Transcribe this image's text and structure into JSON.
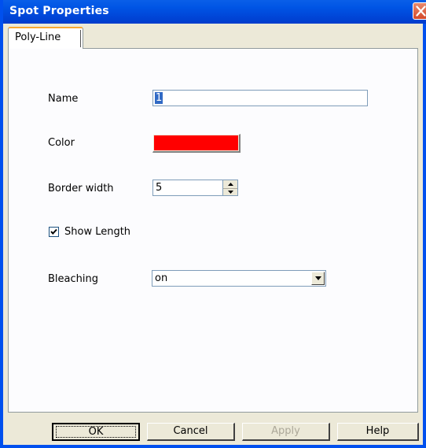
{
  "window": {
    "title": "Spot Properties"
  },
  "tabs": [
    {
      "label": "Poly-Line",
      "selected": true
    }
  ],
  "fields": {
    "name": {
      "label": "Name",
      "value": "1"
    },
    "color": {
      "label": "Color",
      "value": "#ff0000"
    },
    "border_width": {
      "label": "Border width",
      "value": "5"
    },
    "show_length": {
      "label": "Show Length",
      "checked": true
    },
    "bleaching": {
      "label": "Bleaching",
      "value": "on"
    }
  },
  "buttons": {
    "ok": "OK",
    "cancel": "Cancel",
    "apply": "Apply",
    "help": "Help"
  },
  "colors": {
    "titlebar": "#0055e5",
    "panel": "#ece9d8",
    "selected_color": "#ff0000"
  },
  "icons": {
    "close": "close-icon",
    "spin_up": "spin-up-icon",
    "spin_down": "spin-down-icon",
    "dropdown": "chevron-down-icon",
    "check": "checkmark-icon"
  }
}
